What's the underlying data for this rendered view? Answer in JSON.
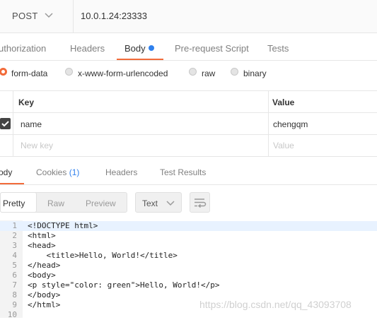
{
  "request": {
    "method": "POST",
    "url": "10.0.1.24:23333"
  },
  "request_tabs": [
    {
      "label": "uthorization",
      "active": false
    },
    {
      "label": "Headers",
      "active": false
    },
    {
      "label": "Body",
      "active": true
    },
    {
      "label": "Pre-request Script",
      "active": false
    },
    {
      "label": "Tests",
      "active": false
    }
  ],
  "body_types": [
    {
      "label": "form-data",
      "selected": true
    },
    {
      "label": "x-www-form-urlencoded",
      "selected": false
    },
    {
      "label": "raw",
      "selected": false
    },
    {
      "label": "binary",
      "selected": false
    }
  ],
  "params_table": {
    "headers": {
      "key": "Key",
      "value": "Value"
    },
    "rows": [
      {
        "key": "name",
        "value": "chengqm",
        "checked": true
      }
    ],
    "new_row": {
      "key_placeholder": "New key",
      "value_placeholder": "Value"
    }
  },
  "response_tabs": [
    {
      "label": "ody",
      "active": true
    },
    {
      "label": "Cookies",
      "count": "(1)",
      "active": false
    },
    {
      "label": "Headers",
      "active": false
    },
    {
      "label": "Test Results",
      "active": false
    }
  ],
  "view_modes": [
    {
      "label": "Pretty",
      "active": true
    },
    {
      "label": "Raw",
      "active": false
    },
    {
      "label": "Preview",
      "active": false
    }
  ],
  "format_select": {
    "value": "Text"
  },
  "code_lines": [
    {
      "n": "1",
      "text": "<!DOCTYPE html>"
    },
    {
      "n": "2",
      "text": "<html>"
    },
    {
      "n": "3",
      "text": "<head>"
    },
    {
      "n": "4",
      "text": "    <title>Hello, World!</title>"
    },
    {
      "n": "5",
      "text": "</head>"
    },
    {
      "n": "6",
      "text": "<body>"
    },
    {
      "n": "7",
      "text": "<p style=\"color: green\">Hello, World!</p>"
    },
    {
      "n": "8",
      "text": "</body>"
    },
    {
      "n": "9",
      "text": "</html>"
    },
    {
      "n": "10",
      "text": ""
    }
  ],
  "watermark": "https://blog.csdn.net/qq_43093708",
  "icons": {
    "method_dropdown": "chevron-down-icon",
    "format_dropdown": "chevron-down-icon",
    "wrap": "wrap-lines-icon",
    "checkbox": "checkmark-icon"
  },
  "colors": {
    "accent": "#f26b3a",
    "blue": "#2f80ed"
  }
}
